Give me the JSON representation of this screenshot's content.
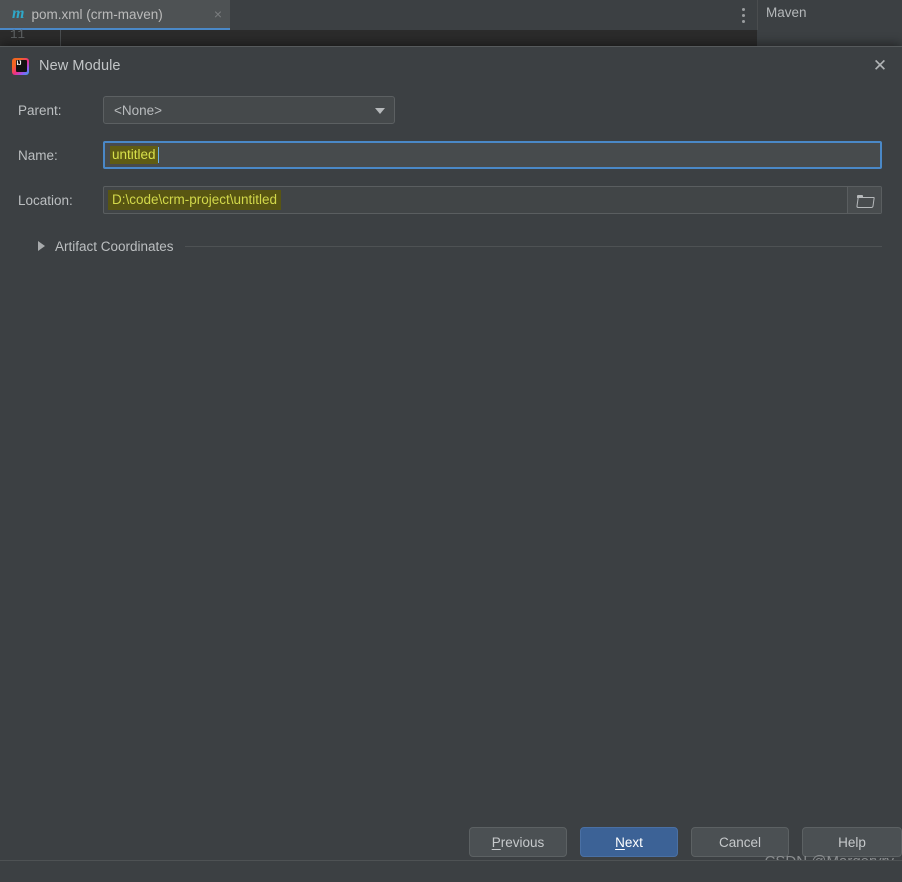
{
  "ide": {
    "tab": {
      "icon": "maven-m-icon",
      "label": "pom.xml (crm-maven)",
      "close": "×"
    },
    "gutter_line_number": "11",
    "tool_window_title": "Maven",
    "options_icon": "kebab-menu-icon"
  },
  "dialog": {
    "icon": "intellij-idea-icon",
    "title": "New Module",
    "close_icon": "✕",
    "fields": {
      "parent": {
        "label": "Parent:",
        "value": "<None>",
        "dropdown_icon": "chevron-down-icon"
      },
      "name": {
        "label": "Name:",
        "value": "untitled"
      },
      "location": {
        "label": "Location:",
        "value": "D:\\code\\crm-project\\untitled",
        "browse_icon": "folder-icon"
      }
    },
    "section": {
      "label": "Artifact Coordinates",
      "expand_icon": "triangle-right-icon",
      "expanded": false
    },
    "buttons": {
      "previous": {
        "mnemonic": "P",
        "rest": "revious"
      },
      "next": {
        "mnemonic": "N",
        "rest": "ext"
      },
      "cancel": "Cancel",
      "help": "Help"
    }
  },
  "watermark": "CSDN @Margeryry",
  "colors": {
    "dialog_bg": "#3c4043",
    "field_bg": "#45494b",
    "accent_blue": "#3c6296",
    "focus_border": "#4a88c7",
    "selection_bg": "#5f5c14",
    "selection_text": "#d7e04a",
    "editor_bg": "#2b2b2b",
    "tab_underline": "#4a88c7"
  }
}
